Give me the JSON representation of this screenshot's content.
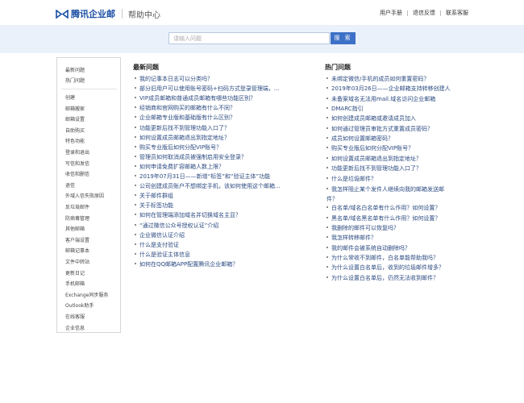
{
  "header": {
    "brand": "腾讯企业邮",
    "section": "帮助中心",
    "links": [
      "用户手册",
      "退信反馈",
      "联系客服"
    ]
  },
  "search": {
    "placeholder": "请输入问题",
    "button_label": "搜 索"
  },
  "sidebar": {
    "top_items": [
      "最新问题",
      "热门问题"
    ],
    "items": [
      "创建",
      "邮箱搬家",
      "邮箱设置",
      "自助购买",
      "特色功能",
      "登录和退出",
      "写信和发信",
      "收信和删信",
      "退信",
      "外域入信失败原因",
      "反垃圾邮件",
      "防病毒管理",
      "其他邮箱",
      "客户端设置",
      "邮箱记事本",
      "文件中转站",
      "更新日记",
      "手机邮箱",
      "Exchange同步服务",
      "Outlook助手",
      "在线客服",
      "企业信息"
    ]
  },
  "latest": {
    "title": "最新问题",
    "items": [
      "我的记事本日志可以分类吗？",
      "部分旧用户可以使用账号密码+扫码方式登录管理端，...",
      "VIP成员邮箱和普通成员邮箱有哪些功能区别？",
      "经销商和官网购买的邮箱有什么不同？",
      "企业邮箱专业版和基础版有什么区别？",
      "功能更新后找不到管理功能入口了？",
      "如何设置成员邮箱退出到指定地址？",
      "购买专业版后如何分配VIP账号？",
      "管理员如何取消成员被强制启用安全登录？",
      "如何申请免费扩容邮箱人数上限？",
      "2019年07月31日——新增“标签”和“验证主体”功能",
      "公司创建成员账户不想绑定手机，该如何使用这个邮箱...",
      "关于邮件群组",
      "关于标签功能",
      "如何在管理端添加域名并切换域名主显？",
      "“通过微信公众号授权认证”介绍",
      "企业微信认证介绍",
      "什么是支付验证",
      "什么是验证主体信息",
      "如何在QQ邮箱APP配置腾讯企业邮箱？"
    ]
  },
  "hot": {
    "title": "热门问题",
    "items": [
      "未绑定微信/手机的成员如何重置密码？",
      "2019年03月26日——企业邮箱支持转移创建人",
      "未备案域名无法用mail.域名访问企业邮箱",
      "DMARC指引",
      "如何创建成员邮箱或邀请成员加入",
      "如何通过管理员审批方式重置成员密码？",
      "成员如何设置邮箱密码？",
      "购买专业版后如何分配VIP账号？",
      "如何设置成员邮箱退出到指定地址？",
      "功能更新后找不到管理功能入口了？",
      "什么是垃圾邮件？",
      "我怎样阻止某个发件人继续向我的邮箱发送邮件？",
      "白名单/域名白名单有什么作用？如何设置？",
      "黑名单/域名黑名单有什么作用？如何设置？",
      "我删除的邮件可以恢复吗？",
      "我怎样转移邮件？",
      "我的邮件会被系统自动删除吗？",
      "为什么常收不到邮件，白名单能帮助我吗？",
      "为什么设置白名单后，收到的垃圾邮件增多？",
      "为什么设置白名单后，仍然无法收到邮件？"
    ]
  },
  "colors": {
    "accent": "#3d70c7",
    "link": "#2b4a80",
    "band": "#eaf1fa"
  }
}
